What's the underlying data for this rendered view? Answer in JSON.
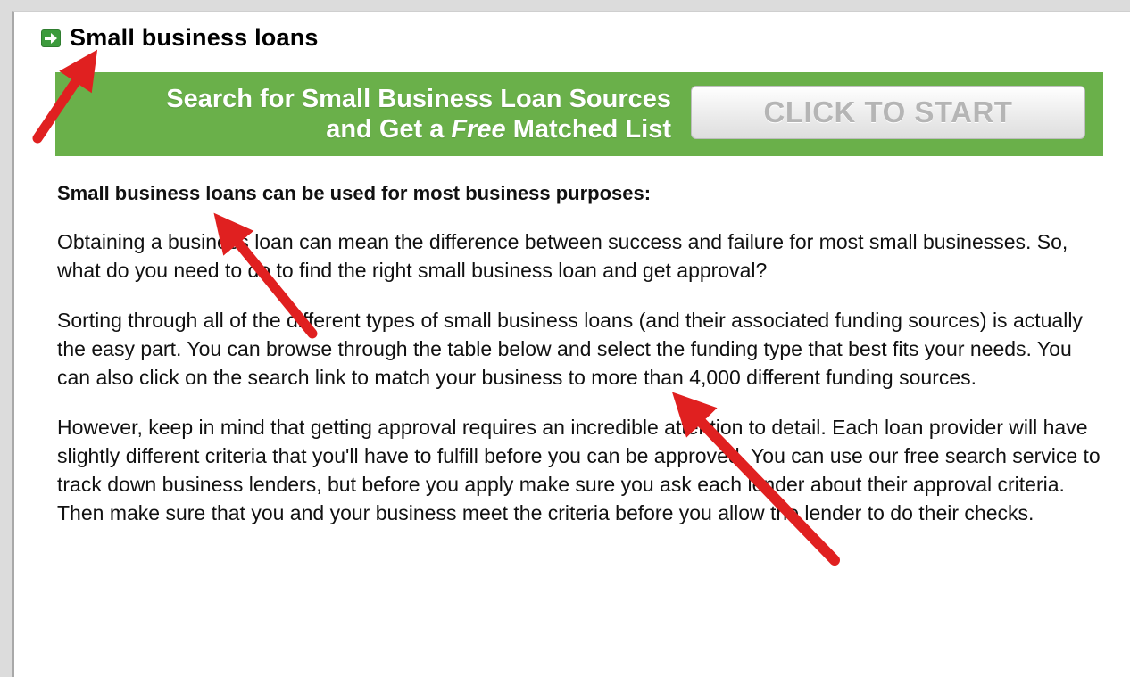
{
  "heading": {
    "icon": "green-arrow-box-icon",
    "title": "Small business loans"
  },
  "banner": {
    "line1": "Search for Small Business Loan Sources",
    "line2_prefix": "and Get a ",
    "line2_emphasis": "Free",
    "line2_suffix": " Matched List",
    "cta_label": "CLICK TO START",
    "color": "#6ab04a"
  },
  "content": {
    "subheading": "Small business loans can be used for most business purposes:",
    "paragraphs": [
      "Obtaining a business loan can mean the difference between success and failure for most small businesses. So, what do you need to do to find the right small business loan and get approval?",
      "Sorting through all of the different types of small business loans (and their associated funding sources) is actually the easy part. You can browse through the table below and select the funding type that best fits your needs. You can also click on the search link to match your business to more than 4,000 different funding sources.",
      "However, keep in mind that getting approval requires an incredible attention to detail. Each loan provider will have slightly different criteria that you'll have to fulfill before you can be approved. You can use our free search service to track down business lenders, but before you apply make sure you ask each lender about their approval criteria. Then make sure that you and your business meet the criteria before you allow the lender to do their checks."
    ]
  },
  "annotations": {
    "arrow_color": "#e02020",
    "arrow_icons": [
      "red-arrow-icon",
      "red-arrow-icon",
      "red-arrow-icon"
    ]
  }
}
